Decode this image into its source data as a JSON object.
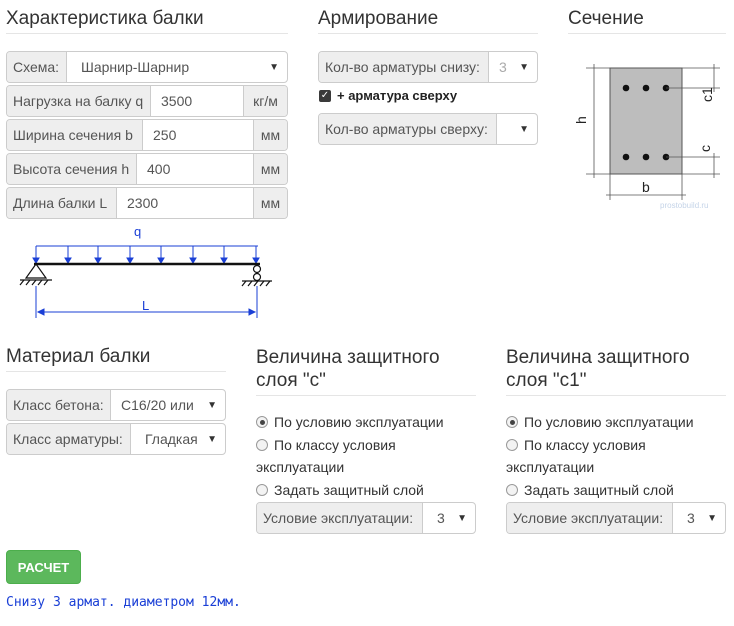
{
  "beam": {
    "title": "Характеристика балки",
    "scheme_label": "Схема:",
    "scheme_value": "Шарнир-Шарнир",
    "load_label": "Нагрузка на балку q",
    "load_value": "3500",
    "load_unit": "кг/м",
    "width_label": "Ширина сечения b",
    "width_value": "250",
    "width_unit": "мм",
    "height_label": "Высота сечения h",
    "height_value": "400",
    "height_unit": "мм",
    "length_label": "Длина балки L",
    "length_value": "2300",
    "length_unit": "мм",
    "diagram_q": "q",
    "diagram_L": "L"
  },
  "reinforcement": {
    "title": "Армирование",
    "bottom_label": "Кол-во арматуры снизу:",
    "bottom_value": "3",
    "top_check_label": "+ арматура сверху",
    "top_label": "Кол-во арматуры сверху:",
    "top_value": ""
  },
  "section": {
    "title": "Сечение",
    "label_h": "h",
    "label_b": "b",
    "label_c": "c",
    "label_c1": "c1",
    "watermark": "prostobuild.ru"
  },
  "material": {
    "title": "Материал балки",
    "concrete_label": "Класс бетона:",
    "concrete_value": "C16/20 или",
    "rebar_label": "Класс арматуры:",
    "rebar_value": "Гладкая"
  },
  "cover_c": {
    "title_line1": "Величина защитного",
    "title_line2": "слоя \"c\"",
    "opt1": "По условию эксплуатации",
    "opt2_line1": "По классу условия",
    "opt2_line2": "эксплуатации",
    "opt3": "Задать защитный слой",
    "cond_label": "Условие эксплуатации:",
    "cond_value": "3"
  },
  "cover_c1": {
    "title_line1": "Величина защитного",
    "title_line2": "слоя \"c1\"",
    "opt1": "По условию эксплуатации",
    "opt2_line1": "По классу условия",
    "opt2_line2": "эксплуатации",
    "opt3": "Задать защитный слой",
    "cond_label": "Условие эксплуатации:",
    "cond_value": "3"
  },
  "action": {
    "calc_label": "РАСЧЕТ",
    "result": "Снизу 3 армат. диаметром 12мм."
  },
  "colors": {
    "button_green": "#5cb85c",
    "result_blue": "#1a3fd6",
    "diagram_blue": "#1a3fd6"
  }
}
